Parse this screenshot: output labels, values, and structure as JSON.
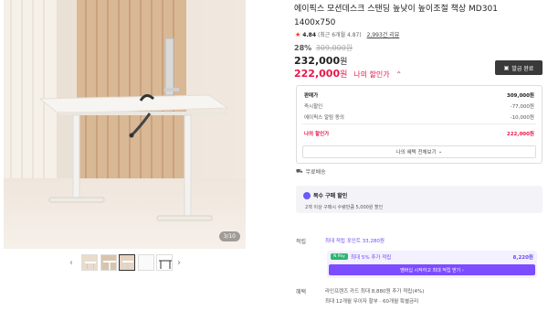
{
  "gallery": {
    "counter": "3/10",
    "prev_label": "‹",
    "next_label": "›"
  },
  "product": {
    "title": "에이픽스 모션데스크 스탠딩 높낮이 높이조절 책상 MD301 1400x750",
    "rating": "4.84",
    "rating_note": "(최근 6개월 4.87",
    "reviews": "2,993건 리뷰"
  },
  "price": {
    "discount_rate": "28%",
    "original": "309,000원",
    "sale_price": "232,000",
    "won": "원",
    "my_price": "222,000",
    "my_price_label": "나의 할인가"
  },
  "coupon_button": "발급 완료",
  "price_box": {
    "head_label": "판매가",
    "head_value": "309,000원",
    "rows": [
      {
        "label": "즉시할인",
        "value": "-77,000원"
      },
      {
        "label": "에이픽스 알림 동의",
        "value": "-10,000원"
      }
    ],
    "final_label": "나의 할인가",
    "final_value": "222,000원",
    "more_label": "나의 혜택 전체보기"
  },
  "shipping": "무료배송",
  "bulk": {
    "title": "복수 구매 할인",
    "desc": "2개 이상 구매시 수량만큼 5,000원 할인"
  },
  "points": {
    "label": "적립",
    "max_line": "최대 적립 포인트 33,280원",
    "badge": "N Pay",
    "extra_text": "최대 5% 추가 적립",
    "extra_amount": "8,220원",
    "cta": "멤버십 시작하고 최대 적립 받기 ›"
  },
  "benefits": {
    "label": "혜택",
    "line1": "라인프렌즈 카드 최대 8,880원 추가 적립(4%)",
    "line2": "최대 12개월 무이자 할부 · 60개월 특별금리"
  }
}
